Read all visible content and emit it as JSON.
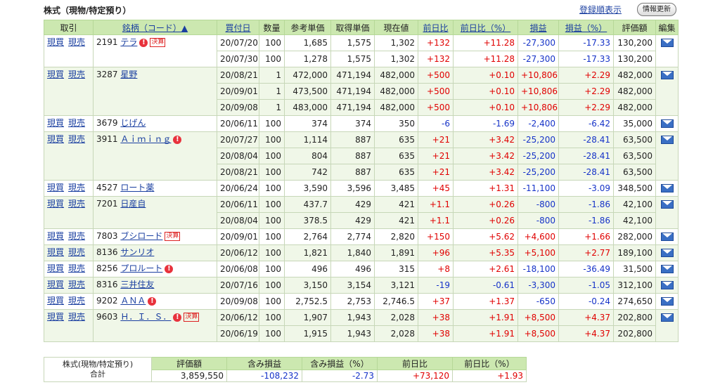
{
  "header": {
    "title": "株式（現物/特定預り）",
    "sort_link": "登録順表示",
    "refresh_button": "情報更新"
  },
  "columns": [
    "取引",
    "銘柄（コード）▲",
    "買付日",
    "数量",
    "参考単価",
    "取得単価",
    "現在値",
    "前日比",
    "前日比（%）",
    "損益",
    "損益（%）",
    "評価額",
    "編集"
  ],
  "actions": {
    "buy": "現買",
    "sell": "現売"
  },
  "colors": {
    "header_bg": "#cce8b0",
    "alt_row_bg": "#f0f7e8",
    "link": "#1a3fa0",
    "positive": "#e00000",
    "negative": "#1633c8"
  },
  "holdings": [
    {
      "code": "2191",
      "name": "テラ",
      "alert": true,
      "kessan": "決算",
      "lots": [
        {
          "date": "20/07/20",
          "qty": "100",
          "ref": "1,685",
          "cost": "1,575",
          "price": "1,302",
          "chg": "+132",
          "chg_pct": "+11.28",
          "pl": "-27,300",
          "pl_pct": "-17.33",
          "value": "130,200"
        },
        {
          "date": "20/07/30",
          "qty": "100",
          "ref": "1,278",
          "cost": "1,575",
          "price": "1,302",
          "chg": "+132",
          "chg_pct": "+11.28",
          "pl": "-27,300",
          "pl_pct": "-17.33",
          "value": "130,200"
        }
      ]
    },
    {
      "code": "3287",
      "name": "星野",
      "alert": false,
      "kessan": "",
      "lots": [
        {
          "date": "20/08/21",
          "qty": "1",
          "ref": "472,000",
          "cost": "471,194",
          "price": "482,000",
          "chg": "+500",
          "chg_pct": "+0.10",
          "pl": "+10,806",
          "pl_pct": "+2.29",
          "value": "482,000"
        },
        {
          "date": "20/09/01",
          "qty": "1",
          "ref": "473,500",
          "cost": "471,194",
          "price": "482,000",
          "chg": "+500",
          "chg_pct": "+0.10",
          "pl": "+10,806",
          "pl_pct": "+2.29",
          "value": "482,000"
        },
        {
          "date": "20/09/08",
          "qty": "1",
          "ref": "483,000",
          "cost": "471,194",
          "price": "482,000",
          "chg": "+500",
          "chg_pct": "+0.10",
          "pl": "+10,806",
          "pl_pct": "+2.29",
          "value": "482,000"
        }
      ]
    },
    {
      "code": "3679",
      "name": "じげん",
      "alert": false,
      "kessan": "",
      "lots": [
        {
          "date": "20/06/11",
          "qty": "100",
          "ref": "374",
          "cost": "374",
          "price": "350",
          "chg": "-6",
          "chg_pct": "-1.69",
          "pl": "-2,400",
          "pl_pct": "-6.42",
          "value": "35,000"
        }
      ]
    },
    {
      "code": "3911",
      "name": "Ａｉｍｉｎｇ",
      "alert": true,
      "kessan": "",
      "lots": [
        {
          "date": "20/07/27",
          "qty": "100",
          "ref": "1,114",
          "cost": "887",
          "price": "635",
          "chg": "+21",
          "chg_pct": "+3.42",
          "pl": "-25,200",
          "pl_pct": "-28.41",
          "value": "63,500"
        },
        {
          "date": "20/08/04",
          "qty": "100",
          "ref": "804",
          "cost": "887",
          "price": "635",
          "chg": "+21",
          "chg_pct": "+3.42",
          "pl": "-25,200",
          "pl_pct": "-28.41",
          "value": "63,500"
        },
        {
          "date": "20/08/21",
          "qty": "100",
          "ref": "742",
          "cost": "887",
          "price": "635",
          "chg": "+21",
          "chg_pct": "+3.42",
          "pl": "-25,200",
          "pl_pct": "-28.41",
          "value": "63,500"
        }
      ]
    },
    {
      "code": "4527",
      "name": "ロート薬",
      "alert": false,
      "kessan": "",
      "lots": [
        {
          "date": "20/06/24",
          "qty": "100",
          "ref": "3,590",
          "cost": "3,596",
          "price": "3,485",
          "chg": "+45",
          "chg_pct": "+1.31",
          "pl": "-11,100",
          "pl_pct": "-3.09",
          "value": "348,500"
        }
      ]
    },
    {
      "code": "7201",
      "name": "日産自",
      "alert": false,
      "kessan": "",
      "lots": [
        {
          "date": "20/06/11",
          "qty": "100",
          "ref": "437.7",
          "cost": "429",
          "price": "421",
          "chg": "+1.1",
          "chg_pct": "+0.26",
          "pl": "-800",
          "pl_pct": "-1.86",
          "value": "42,100"
        },
        {
          "date": "20/08/04",
          "qty": "100",
          "ref": "378.5",
          "cost": "429",
          "price": "421",
          "chg": "+1.1",
          "chg_pct": "+0.26",
          "pl": "-800",
          "pl_pct": "-1.86",
          "value": "42,100"
        }
      ]
    },
    {
      "code": "7803",
      "name": "ブシロード",
      "alert": false,
      "kessan": "決算",
      "lots": [
        {
          "date": "20/09/01",
          "qty": "100",
          "ref": "2,764",
          "cost": "2,774",
          "price": "2,820",
          "chg": "+150",
          "chg_pct": "+5.62",
          "pl": "+4,600",
          "pl_pct": "+1.66",
          "value": "282,000"
        }
      ]
    },
    {
      "code": "8136",
      "name": "サンリオ",
      "alert": false,
      "kessan": "",
      "lots": [
        {
          "date": "20/06/12",
          "qty": "100",
          "ref": "1,821",
          "cost": "1,840",
          "price": "1,891",
          "chg": "+96",
          "chg_pct": "+5.35",
          "pl": "+5,100",
          "pl_pct": "+2.77",
          "value": "189,100"
        }
      ]
    },
    {
      "code": "8256",
      "name": "プロルート",
      "alert": true,
      "kessan": "",
      "lots": [
        {
          "date": "20/06/08",
          "qty": "100",
          "ref": "496",
          "cost": "496",
          "price": "315",
          "chg": "+8",
          "chg_pct": "+2.61",
          "pl": "-18,100",
          "pl_pct": "-36.49",
          "value": "31,500"
        }
      ]
    },
    {
      "code": "8316",
      "name": "三井住友",
      "alert": false,
      "kessan": "",
      "lots": [
        {
          "date": "20/07/16",
          "qty": "100",
          "ref": "3,150",
          "cost": "3,154",
          "price": "3,121",
          "chg": "-19",
          "chg_pct": "-0.61",
          "pl": "-3,300",
          "pl_pct": "-1.05",
          "value": "312,100"
        }
      ]
    },
    {
      "code": "9202",
      "name": "ＡＮＡ",
      "alert": true,
      "kessan": "",
      "lots": [
        {
          "date": "20/09/08",
          "qty": "100",
          "ref": "2,752.5",
          "cost": "2,753",
          "price": "2,746.5",
          "chg": "+37",
          "chg_pct": "+1.37",
          "pl": "-650",
          "pl_pct": "-0.24",
          "value": "274,650"
        }
      ]
    },
    {
      "code": "9603",
      "name": "Ｈ．Ｉ．Ｓ．",
      "alert": true,
      "kessan": "決算",
      "lots": [
        {
          "date": "20/06/12",
          "qty": "100",
          "ref": "1,907",
          "cost": "1,943",
          "price": "2,028",
          "chg": "+38",
          "chg_pct": "+1.91",
          "pl": "+8,500",
          "pl_pct": "+4.37",
          "value": "202,800"
        },
        {
          "date": "20/06/19",
          "qty": "100",
          "ref": "1,915",
          "cost": "1,943",
          "price": "2,028",
          "chg": "+38",
          "chg_pct": "+1.91",
          "pl": "+8,500",
          "pl_pct": "+4.37",
          "value": "202,800"
        }
      ]
    }
  ],
  "summary": {
    "label_line1": "株式(現物/特定預り)",
    "label_line2": "合計",
    "headers": [
      "評価額",
      "含み損益",
      "含み損益（%）",
      "前日比",
      "前日比（%）"
    ],
    "values": [
      "3,859,550",
      "-108,232",
      "-2.73",
      "+73,120",
      "+1.93"
    ]
  }
}
